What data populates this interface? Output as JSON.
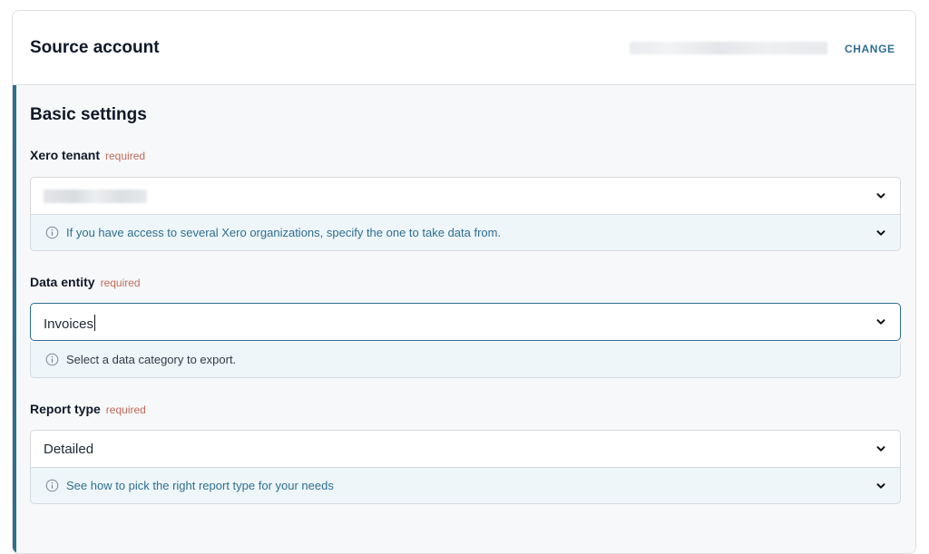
{
  "header": {
    "title": "Source account",
    "change_label": "CHANGE"
  },
  "section": {
    "title": "Basic settings"
  },
  "fields": [
    {
      "label": "Xero tenant",
      "required": "required",
      "value": "",
      "hint": "If you have access to several Xero organizations, specify the one to take data from.",
      "hint_expandable": true
    },
    {
      "label": "Data entity",
      "required": "required",
      "value": "Invoices",
      "hint": "Select a data category to export.",
      "hint_expandable": false
    },
    {
      "label": "Report type",
      "required": "required",
      "value": "Detailed",
      "hint": "See how to pick the right report type for your needs",
      "hint_expandable": true
    }
  ],
  "colors": {
    "accent": "#2f6e91",
    "required": "#c46a5c",
    "hint_bg": "#eef6fa"
  },
  "icons": [
    "chevron-down-icon",
    "info-icon"
  ]
}
